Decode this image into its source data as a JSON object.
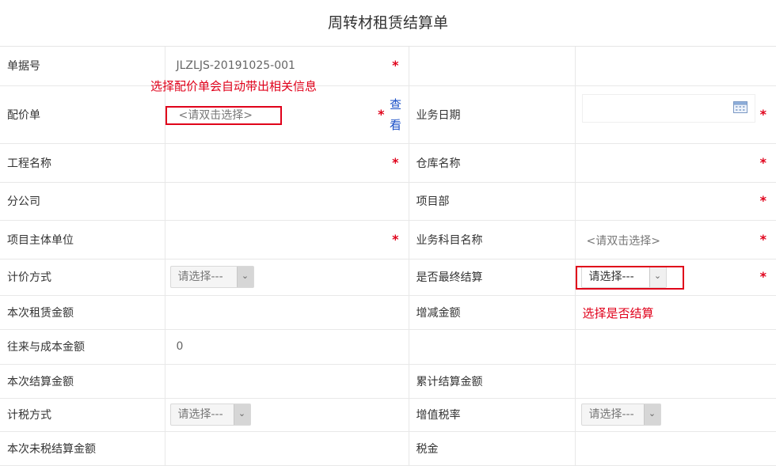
{
  "title": "周转材租赁结算单",
  "fields": {
    "doc_no_label": "单据号",
    "doc_no_value": "JLZLJS-20191025-001",
    "price_sheet_label": "配价单",
    "price_sheet_placeholder": "<请双击选择>",
    "view_link": "查看",
    "business_date_label": "业务日期",
    "project_name_label": "工程名称",
    "warehouse_label": "仓库名称",
    "branch_label": "分公司",
    "project_dept_label": "项目部",
    "project_owner_label": "项目主体单位",
    "business_subject_label": "业务科目名称",
    "business_subject_placeholder": "<请双击选择>",
    "pricing_method_label": "计价方式",
    "pricing_method_value": "请选择---",
    "is_final_label": "是否最终结算",
    "is_final_value": "请选择---",
    "rent_amount_label": "本次租赁金额",
    "adjust_amount_label": "增减金额",
    "cost_amount_label": "往来与成本金额",
    "cost_amount_value": "0",
    "settle_amount_label": "本次结算金额",
    "cum_settle_label": "累计结算金额",
    "tax_method_label": "计税方式",
    "tax_method_value": "请选择---",
    "vat_rate_label": "增值税率",
    "vat_rate_value": "请选择---",
    "pretax_amount_label": "本次未税结算金额",
    "tax_label": "税金"
  },
  "required_mark": "*",
  "annotations": {
    "price_sheet_hint": "选择配价单会自动带出相关信息",
    "final_hint": "选择是否结算"
  },
  "colors": {
    "required": "#e0001a",
    "link": "#1a4fc7",
    "annotation": "#e0001a"
  }
}
